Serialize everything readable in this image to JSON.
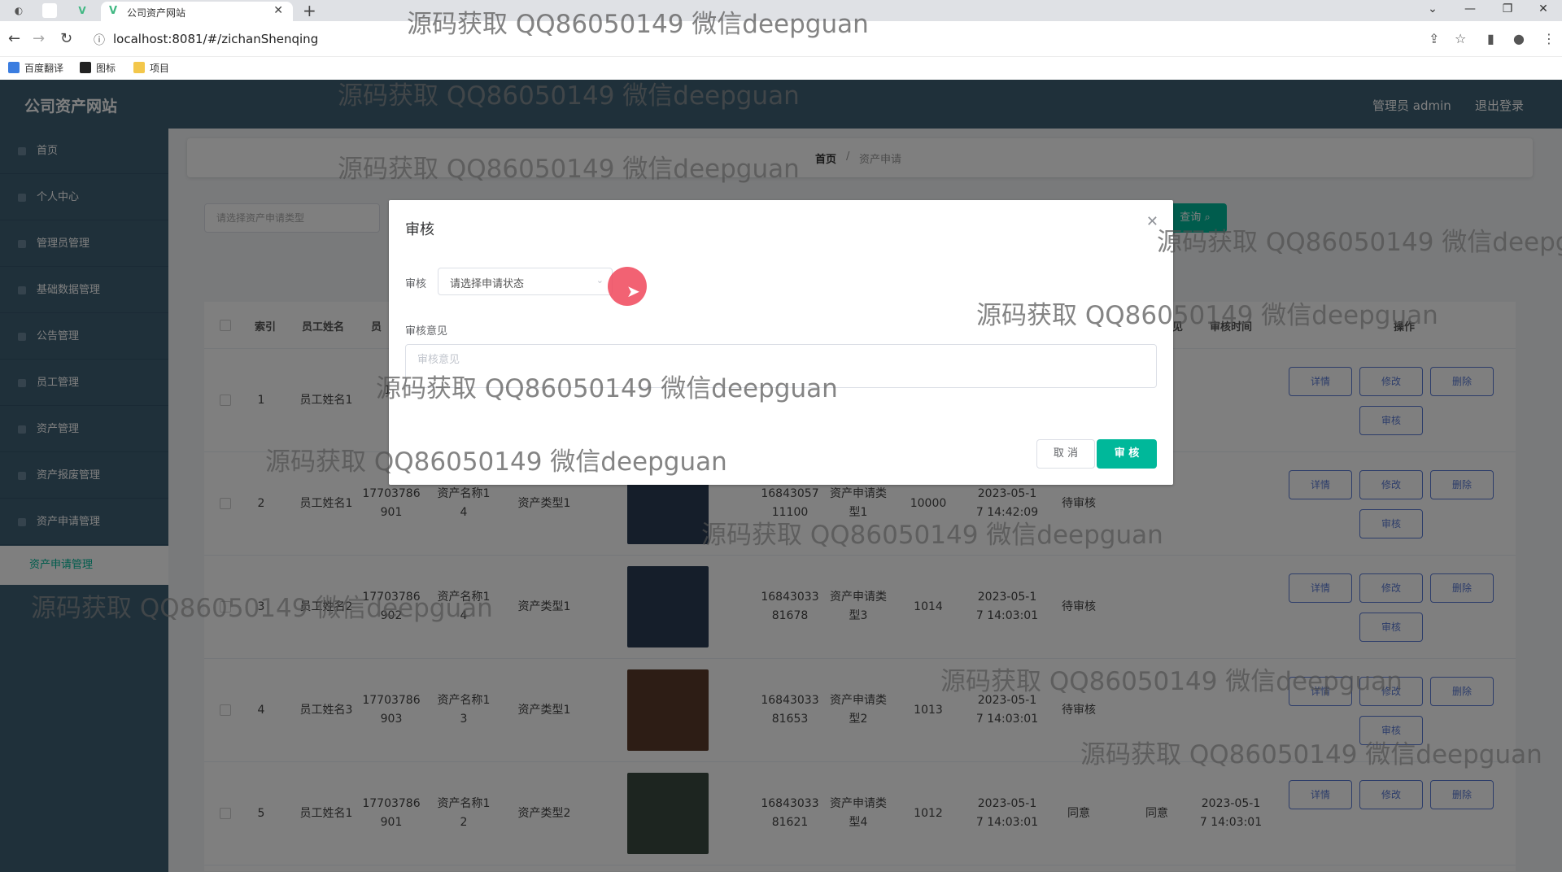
{
  "browser": {
    "tab_title": "公司资产网站",
    "url": "localhost:8081/#/zichanShenqing",
    "bookmarks": [
      "百度翻译",
      "图标",
      "项目"
    ]
  },
  "app": {
    "brand": "公司资产网站",
    "user_label": "管理员 admin",
    "logout": "退出登录",
    "sidebar": [
      {
        "label": "首页"
      },
      {
        "label": "个人中心"
      },
      {
        "label": "管理员管理"
      },
      {
        "label": "基础数据管理"
      },
      {
        "label": "公告管理"
      },
      {
        "label": "员工管理"
      },
      {
        "label": "资产管理"
      },
      {
        "label": "资产报废管理"
      },
      {
        "label": "资产申请管理"
      }
    ],
    "sidebar_sub": "资产申请管理",
    "breadcrumb": {
      "home": "首页",
      "sep": "/",
      "current": "资产申请"
    },
    "filter_placeholder": "请选择资产申请类型",
    "query_btn": "查询",
    "table": {
      "headers": [
        "索引",
        "员工姓名",
        "员",
        "审核时间",
        "操作"
      ],
      "headers_right": [
        "见"
      ],
      "rows": [
        {
          "index": "1",
          "name": "员工姓名1",
          "phone": "17",
          "asset": "",
          "type": "",
          "no": "",
          "apply_type": "",
          "amount": "",
          "time": "",
          "status": "",
          "opinion": "",
          "review_time": "",
          "has_img": false
        },
        {
          "index": "2",
          "name": "员工姓名1",
          "phone": "17703786 901",
          "asset": "资产名称1 4",
          "type": "资产类型1",
          "no": "16843057 11100",
          "apply_type": "资产申请类 型1",
          "amount": "10000",
          "time": "2023-05-1 7 14:42:09",
          "status": "待审核",
          "opinion": "",
          "review_time": "",
          "has_img": true
        },
        {
          "index": "3",
          "name": "员工姓名2",
          "phone": "17703786 902",
          "asset": "资产名称1 4",
          "type": "资产类型1",
          "no": "16843033 81678",
          "apply_type": "资产申请类 型3",
          "amount": "1014",
          "time": "2023-05-1 7 14:03:01",
          "status": "待审核",
          "opinion": "",
          "review_time": "",
          "has_img": true
        },
        {
          "index": "4",
          "name": "员工姓名3",
          "phone": "17703786 903",
          "asset": "资产名称1 3",
          "type": "资产类型1",
          "no": "16843033 81653",
          "apply_type": "资产申请类 型2",
          "amount": "1013",
          "time": "2023-05-1 7 14:03:01",
          "status": "待审核",
          "opinion": "",
          "review_time": "",
          "has_img": true
        },
        {
          "index": "5",
          "name": "员工姓名1",
          "phone": "17703786 901",
          "asset": "资产名称1 2",
          "type": "资产类型2",
          "no": "16843033 81621",
          "apply_type": "资产申请类 型4",
          "amount": "1012",
          "time": "2023-05-1 7 14:03:01",
          "status": "同意",
          "opinion": "同意",
          "review_time": "2023-05-1 7 14:03:01",
          "has_img": true
        }
      ],
      "op_labels": {
        "detail": "详情",
        "edit": "修改",
        "delete": "删除",
        "review": "审核"
      }
    }
  },
  "dialog": {
    "title": "审核",
    "field_label": "审核",
    "select_placeholder": "请选择申请状态",
    "opinion_label": "审核意见",
    "opinion_placeholder": "审核意见",
    "cancel": "取 消",
    "confirm": "审 核"
  },
  "watermark": "源码获取 QQ86050149 微信deepguan",
  "colors": {
    "header": "#3e6075",
    "accent": "#00b89a",
    "op": "#5b7bd5"
  }
}
